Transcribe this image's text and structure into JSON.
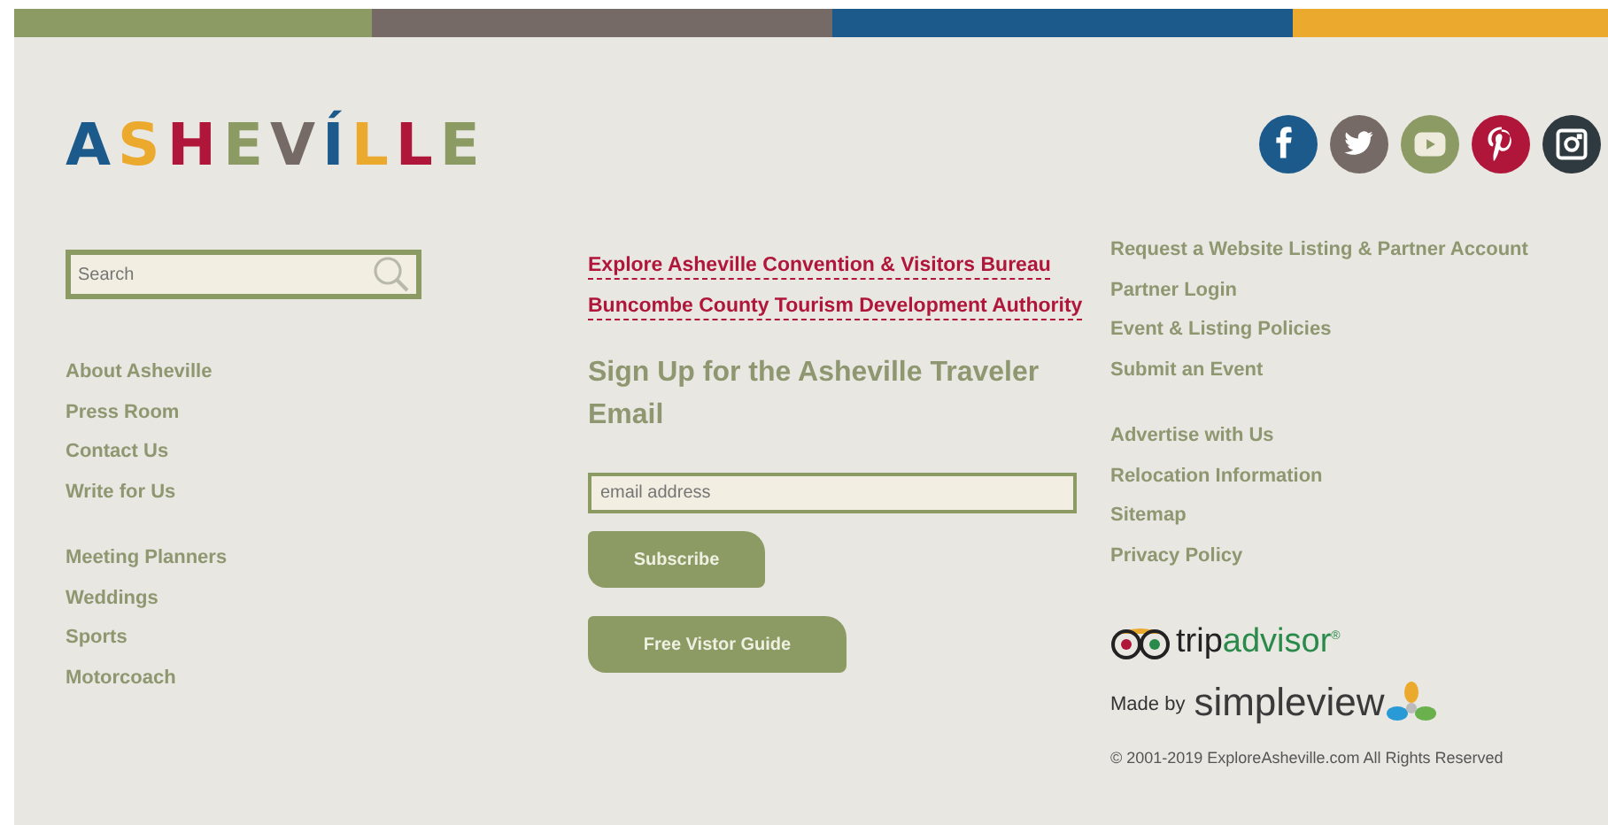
{
  "color_bar": [
    {
      "color": "#8c9a64"
    },
    {
      "color": "#766a66"
    },
    {
      "color": "#1c5a8c"
    },
    {
      "color": "#eba92e"
    }
  ],
  "logo": {
    "text": "ASHEVÍLLE"
  },
  "social_links": [
    {
      "kind": "facebook",
      "color": "#1c5a8c"
    },
    {
      "kind": "twitter",
      "color": "#766a66"
    },
    {
      "kind": "youtube",
      "color": "#8c9a64"
    },
    {
      "kind": "pinterest",
      "color": "#b0153a"
    },
    {
      "kind": "instagram",
      "color": "#2f3a40"
    }
  ],
  "search": {
    "placeholder": "Search"
  },
  "left_links": [
    [
      "About Asheville",
      "Press Room",
      "Contact Us",
      "Write for Us"
    ],
    [
      "Meeting Planners",
      "Weddings",
      "Sports",
      "Motorcoach"
    ]
  ],
  "partner_links": [
    "Explore Asheville Convention & Visitors Bureau",
    "Buncombe County Tourism Development Authority"
  ],
  "signup": {
    "heading": "Sign Up for the Asheville Traveler Email",
    "placeholder": "email address",
    "button": "Subscribe"
  },
  "guide_button": "Free Vistor Guide",
  "right_links": [
    [
      "Request a Website Listing & Partner Account",
      "Partner Login",
      "Event & Listing Policies",
      "Submit an Event"
    ],
    [
      "Advertise with Us",
      "Relocation Information",
      "Sitemap",
      "Privacy Policy"
    ]
  ],
  "tripadvisor": {
    "part_1": "trip",
    "part_2": "advisor",
    "mark": "®"
  },
  "made_by": {
    "label": "Made by",
    "brand": "simpleview"
  },
  "copyright": "© 2001-2019 ExploreAsheville.com All Rights Reserved"
}
